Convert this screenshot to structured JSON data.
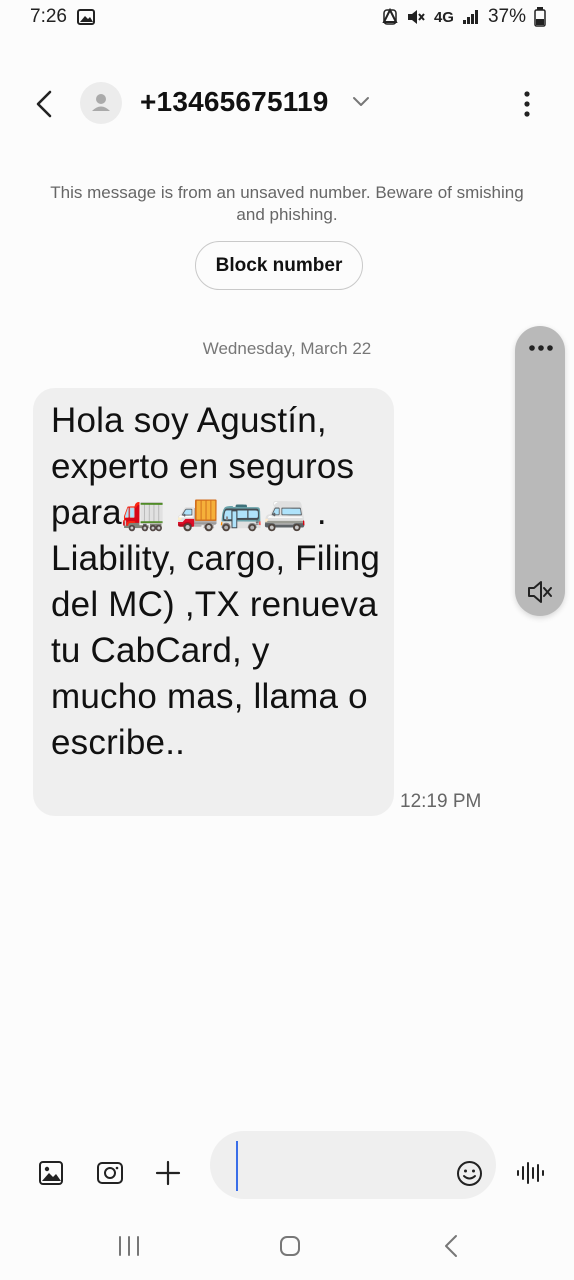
{
  "status_bar": {
    "time": "7:26",
    "network": "4G",
    "battery": "37%"
  },
  "header": {
    "contact": "+13465675119"
  },
  "warning": {
    "text": "This message is from an unsaved number. Beware of smishing and phishing.",
    "block_label": "Block number"
  },
  "conversation": {
    "date": "Wednesday, March 22",
    "message": {
      "text": "Hola soy Agustín, experto en seguros para🚛 🚚🚌🚐 . Liability, cargo, Filing del MC) ,TX renueva tu CabCard, y mucho mas, llama o escribe..",
      "time": "12:19 PM"
    }
  },
  "colors": {
    "background": "#fcfcfc",
    "bubble": "#efefef",
    "caret": "#3a6ee8",
    "float_panel": "#b9b9b9"
  }
}
